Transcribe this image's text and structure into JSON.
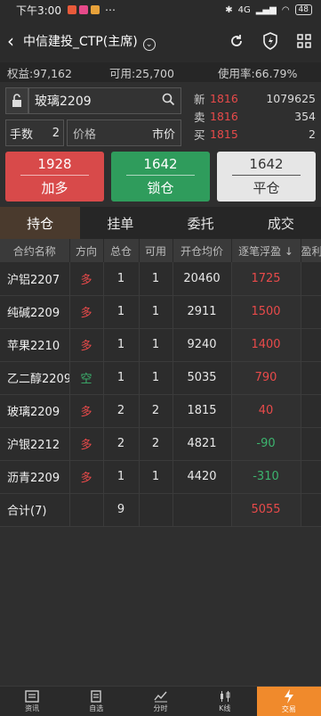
{
  "status_bar": {
    "time": "下午3:00",
    "network": "4G",
    "battery": "48"
  },
  "header": {
    "title": "中信建投_CTP(主席)"
  },
  "account": {
    "equity": "权益:97,162",
    "available": "可用:25,700",
    "usage": "使用率:66.79%"
  },
  "order": {
    "symbol": "玻璃2209",
    "qty_label": "手数",
    "qty_value": "2",
    "price_label": "价格",
    "price_value": "市价"
  },
  "quotes": [
    {
      "label": "新",
      "price": "1816",
      "volume": "1079625"
    },
    {
      "label": "卖",
      "price": "1816",
      "volume": "354"
    },
    {
      "label": "买",
      "price": "1815",
      "volume": "2"
    }
  ],
  "actions": {
    "buy": {
      "price": "1928",
      "label": "加多"
    },
    "lock": {
      "price": "1642",
      "label": "锁仓"
    },
    "close": {
      "price": "1642",
      "label": "平仓"
    }
  },
  "tabs": [
    "持仓",
    "挂单",
    "委托",
    "成交"
  ],
  "table": {
    "headers": [
      "合约名称",
      "方向",
      "总仓",
      "可用",
      "开仓均价",
      "逐笔浮盈 ↓",
      "盈利"
    ],
    "rows": [
      {
        "name": "沪铝2207",
        "dir": "多",
        "dir_color": "#e84a4a",
        "total": "1",
        "avail": "1",
        "avg": "20460",
        "pl": "1725",
        "pl_color": "#e84a4a"
      },
      {
        "name": "纯碱2209",
        "dir": "多",
        "dir_color": "#e84a4a",
        "total": "1",
        "avail": "1",
        "avg": "2911",
        "pl": "1500",
        "pl_color": "#e84a4a"
      },
      {
        "name": "苹果2210",
        "dir": "多",
        "dir_color": "#e84a4a",
        "total": "1",
        "avail": "1",
        "avg": "9240",
        "pl": "1400",
        "pl_color": "#e84a4a"
      },
      {
        "name": "乙二醇2209",
        "dir": "空",
        "dir_color": "#3cb46e",
        "total": "1",
        "avail": "1",
        "avg": "5035",
        "pl": "790",
        "pl_color": "#e84a4a"
      },
      {
        "name": "玻璃2209",
        "dir": "多",
        "dir_color": "#e84a4a",
        "total": "2",
        "avail": "2",
        "avg": "1815",
        "pl": "40",
        "pl_color": "#e84a4a"
      },
      {
        "name": "沪银2212",
        "dir": "多",
        "dir_color": "#e84a4a",
        "total": "2",
        "avail": "2",
        "avg": "4821",
        "pl": "-90",
        "pl_color": "#3cb46e"
      },
      {
        "name": "沥青2209",
        "dir": "多",
        "dir_color": "#e84a4a",
        "total": "1",
        "avail": "1",
        "avg": "4420",
        "pl": "-310",
        "pl_color": "#3cb46e"
      }
    ],
    "total": {
      "name": "合计(7)",
      "total": "9",
      "pl": "5055",
      "pl_color": "#e84a4a"
    }
  },
  "bottom_nav": [
    {
      "label": "资讯",
      "icon": "news-icon"
    },
    {
      "label": "自选",
      "icon": "watchlist-icon"
    },
    {
      "label": "分时",
      "icon": "timeshare-icon"
    },
    {
      "label": "K线",
      "icon": "kline-icon"
    },
    {
      "label": "交易",
      "icon": "trade-icon"
    }
  ]
}
